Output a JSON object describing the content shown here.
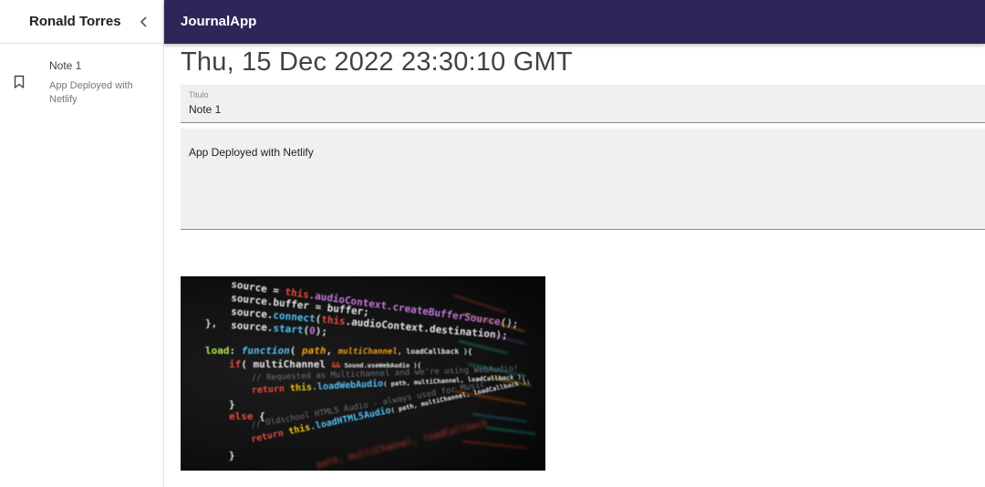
{
  "sidebar": {
    "user_name": "Ronald Torres",
    "collapse_icon": "chevron-left-icon",
    "notes": [
      {
        "title": "Note 1",
        "body": "App Deployed with Netlify",
        "icon": "bookmark-icon"
      }
    ]
  },
  "topbar": {
    "title": "JournalApp",
    "background": "#2d2658"
  },
  "main": {
    "date": "Thu, 15 Dec 2022 23:30:10 GMT",
    "title_field": {
      "label": "Titulo",
      "value": "Note 1"
    },
    "body_field": {
      "value": "App Deployed with Netlify"
    },
    "image": {
      "description_lines": [
        "source = this.audioContext.createBufferSource();",
        "source.buffer = buffer;",
        "source.connect(this.audioContext.destination);",
        "source.start(0);",
        "},",
        "load: function( path, multiChannel, loadCallback ){",
        "if( multiChannel && Sound.useWebAudio ){",
        "// Requested as Multichannel and we're using WebAudio!",
        "return this.loadWebAudio( path, multiChannel, loadCallback );",
        "}",
        "else {",
        "// Oldschool HTML5 Audio - always used for Music",
        "return this.loadHTML5Audio( path, multiChannel, loadCallback );",
        "}"
      ]
    }
  }
}
